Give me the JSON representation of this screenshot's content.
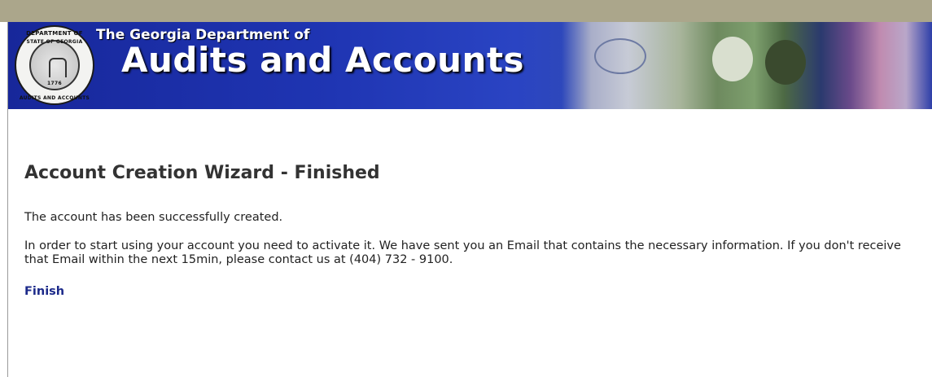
{
  "header": {
    "org_prefix": "The Georgia Department of",
    "org_name": "Audits and Accounts",
    "seal": {
      "top_text": "DEPARTMENT OF",
      "middle_text": "STATE OF GEORGIA",
      "bottom_text": "AUDITS AND ACCOUNTS",
      "year": "1776"
    },
    "colors": {
      "banner_blue": "#1f35b3",
      "top_strip": "#aba68b"
    }
  },
  "main": {
    "title": "Account Creation Wizard - Finished",
    "success_message": "The account has been successfully created.",
    "activation_message": "In order to start using your account you need to activate it. We have sent you an Email that contains the necessary information. If you don't receive that Email within the next 15min, please contact us at (404) 732 - 9100.",
    "finish_label": "Finish",
    "link_color": "#1c2a8a"
  }
}
